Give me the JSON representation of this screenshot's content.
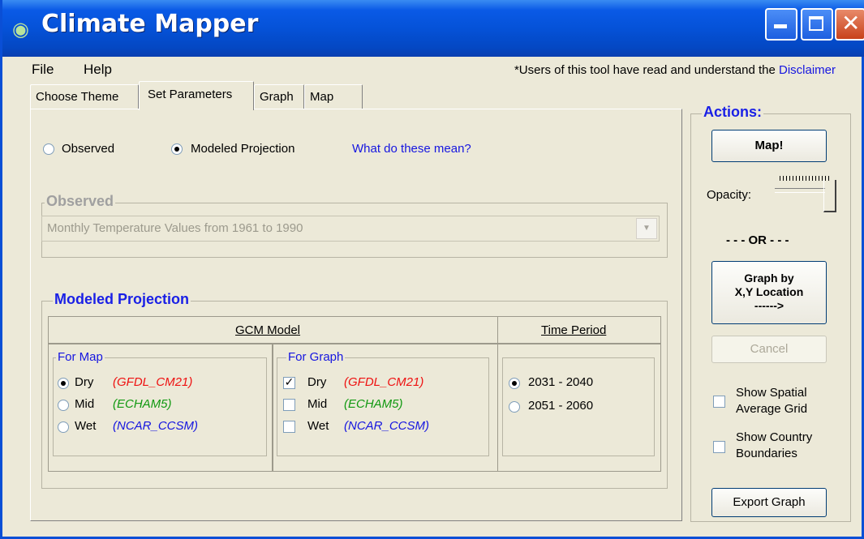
{
  "window": {
    "title": "Climate Mapper",
    "app_icon": "globe-icon"
  },
  "menu": {
    "file": "File",
    "help": "Help"
  },
  "notice": {
    "text": "*Users of this tool have read and understand the ",
    "link": "Disclaimer"
  },
  "tabs": [
    {
      "label": "Choose Theme",
      "active": false
    },
    {
      "label": "Set Parameters",
      "active": true
    },
    {
      "label": "Graph",
      "active": false
    },
    {
      "label": "Map",
      "active": false
    }
  ],
  "data_type": {
    "observed_label": "Observed",
    "modeled_label": "Modeled Projection",
    "selected": "Modeled Projection",
    "help_link": "What do these mean?"
  },
  "observed": {
    "group_title": "Observed",
    "combo_value": "Monthly Temperature Values from 1961 to 1990"
  },
  "modeled": {
    "group_title": "Modeled Projection",
    "gcm_header": "GCM Model",
    "time_header": "Time Period",
    "for_map": {
      "title": "For Map",
      "options": [
        {
          "label": "Dry",
          "model": "(GFDL_CM21)",
          "color": "#ee1111",
          "selected": true
        },
        {
          "label": "Mid",
          "model": "(ECHAM5)",
          "color": "#119911",
          "selected": false
        },
        {
          "label": "Wet",
          "model": "(NCAR_CCSM)",
          "color": "#1515e0",
          "selected": false
        }
      ]
    },
    "for_graph": {
      "title": "For Graph",
      "options": [
        {
          "label": "Dry",
          "model": "(GFDL_CM21)",
          "color": "#ee1111",
          "checked": true
        },
        {
          "label": "Mid",
          "model": "(ECHAM5)",
          "color": "#119911",
          "checked": false
        },
        {
          "label": "Wet",
          "model": "(NCAR_CCSM)",
          "color": "#1515e0",
          "checked": false
        }
      ]
    },
    "time_periods": [
      {
        "label": "2031 - 2040",
        "selected": true
      },
      {
        "label": "2051 - 2060",
        "selected": false
      }
    ]
  },
  "actions": {
    "title": "Actions:",
    "map_button": "Map!",
    "opacity_label": "Opacity:",
    "opacity_level": 1.0,
    "or_text": "- - - OR - - -",
    "graph_button_line1": "Graph by",
    "graph_button_line2": "X,Y Location",
    "graph_button_line3": "------>",
    "cancel_button": "Cancel",
    "show_spatial_line1": "Show Spatial",
    "show_spatial_line2": "Average Grid",
    "show_country_line1": "Show Country",
    "show_country_line2": "Boundaries",
    "export_button": "Export Graph"
  }
}
